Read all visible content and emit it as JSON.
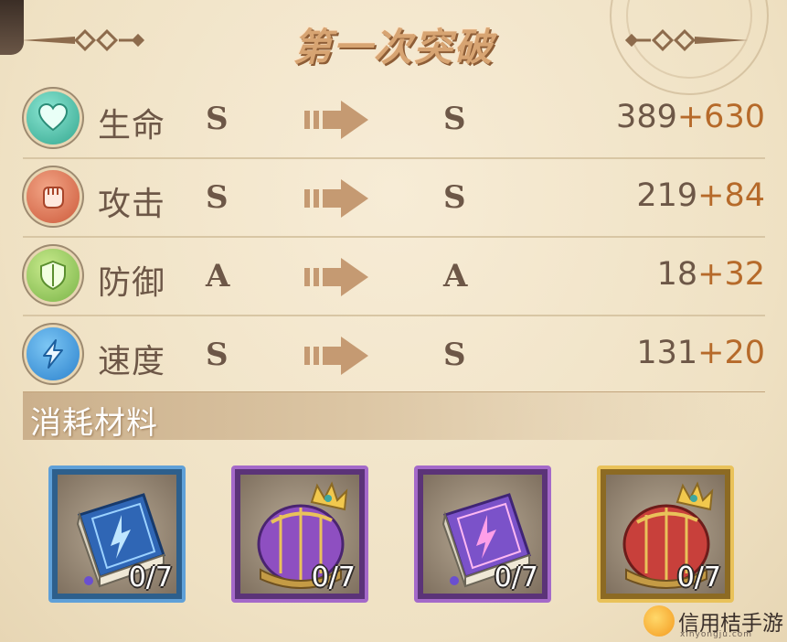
{
  "title": "第一次突破",
  "stats": [
    {
      "name": "生命",
      "icon": "heart-icon",
      "from": "S",
      "to": "S",
      "base": "389",
      "bonus": "+630"
    },
    {
      "name": "攻击",
      "icon": "fist-icon",
      "from": "S",
      "to": "S",
      "base": "219",
      "bonus": "+84"
    },
    {
      "name": "防御",
      "icon": "shield-icon",
      "from": "A",
      "to": "A",
      "base": "18",
      "bonus": "+32"
    },
    {
      "name": "速度",
      "icon": "lightning-icon",
      "from": "S",
      "to": "S",
      "base": "131",
      "bonus": "+20"
    }
  ],
  "materials": {
    "title": "消耗材料",
    "items": [
      {
        "icon": "blue-skill-book-icon",
        "rarity": "blue",
        "count": "0/7"
      },
      {
        "icon": "purple-crown-icon",
        "rarity": "purple",
        "count": "0/7"
      },
      {
        "icon": "purple-skill-book-icon",
        "rarity": "purple",
        "count": "0/7"
      },
      {
        "icon": "gold-crown-icon",
        "rarity": "gold",
        "count": "0/7"
      }
    ]
  },
  "watermark": {
    "name": "信用桔手游",
    "url": "xinyongju.com"
  },
  "colors": {
    "accent": "#b66a2a",
    "text": "#6d5747",
    "title": "#d7a472"
  }
}
